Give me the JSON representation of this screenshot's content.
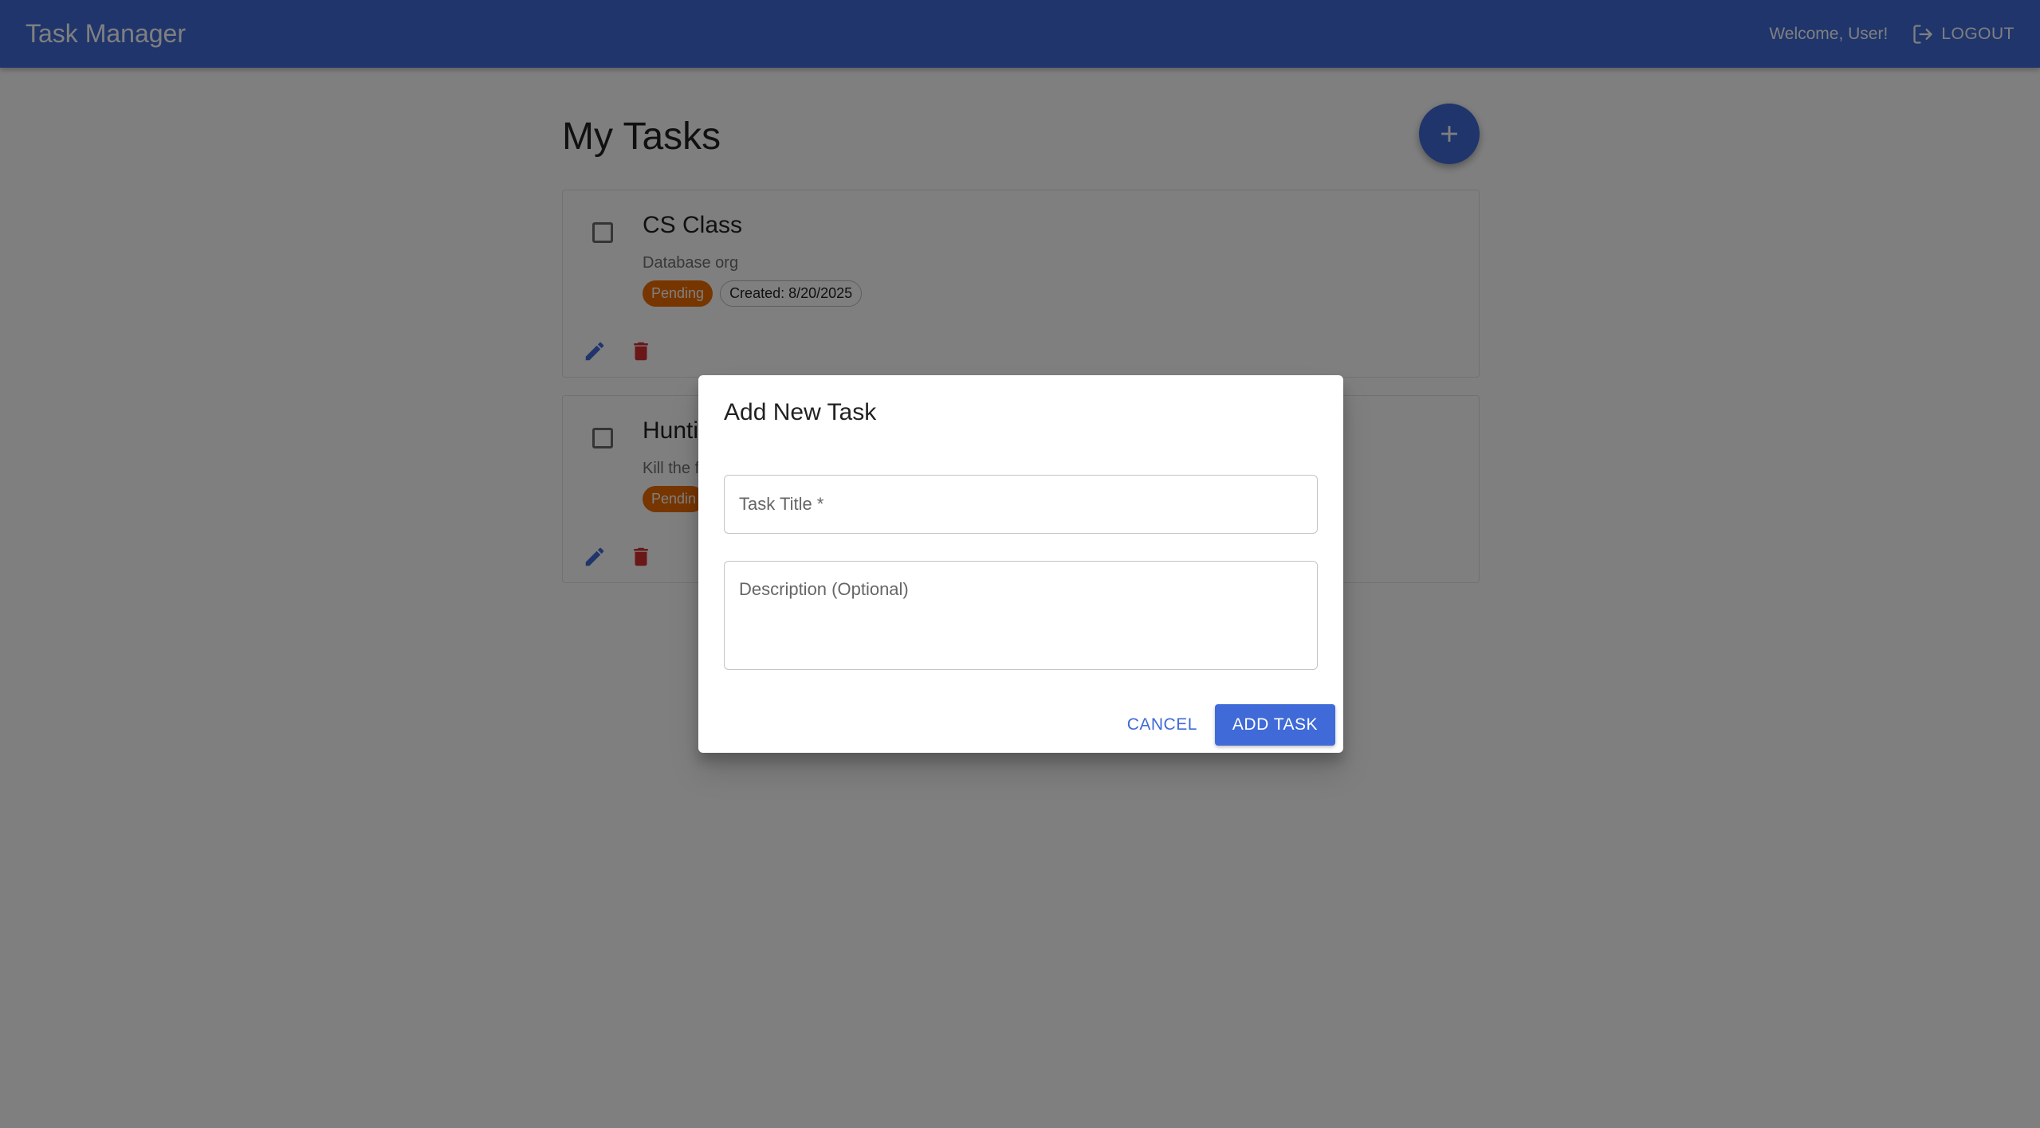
{
  "appbar": {
    "title": "Task Manager",
    "welcome": "Welcome, User!",
    "logout_label": "LOGOUT",
    "logout_icon": "logout-icon"
  },
  "page": {
    "title": "My Tasks",
    "fab_icon": "plus-icon"
  },
  "tasks": [
    {
      "title": "CS Class",
      "description": "Database org",
      "status": "Pending",
      "created": "Created: 8/20/2025",
      "completed": false
    },
    {
      "title": "Huntin",
      "description": "Kill the f",
      "status": "Pendin",
      "created": "",
      "completed": false
    }
  ],
  "dialog": {
    "title": "Add New Task",
    "title_field_label": "Task Title *",
    "description_field_label": "Description (Optional)",
    "cancel_label": "CANCEL",
    "submit_label": "ADD TASK"
  },
  "colors": {
    "primary": "#3f6ad8",
    "status_pending": "#ef6c00",
    "delete": "#d32f2f"
  }
}
